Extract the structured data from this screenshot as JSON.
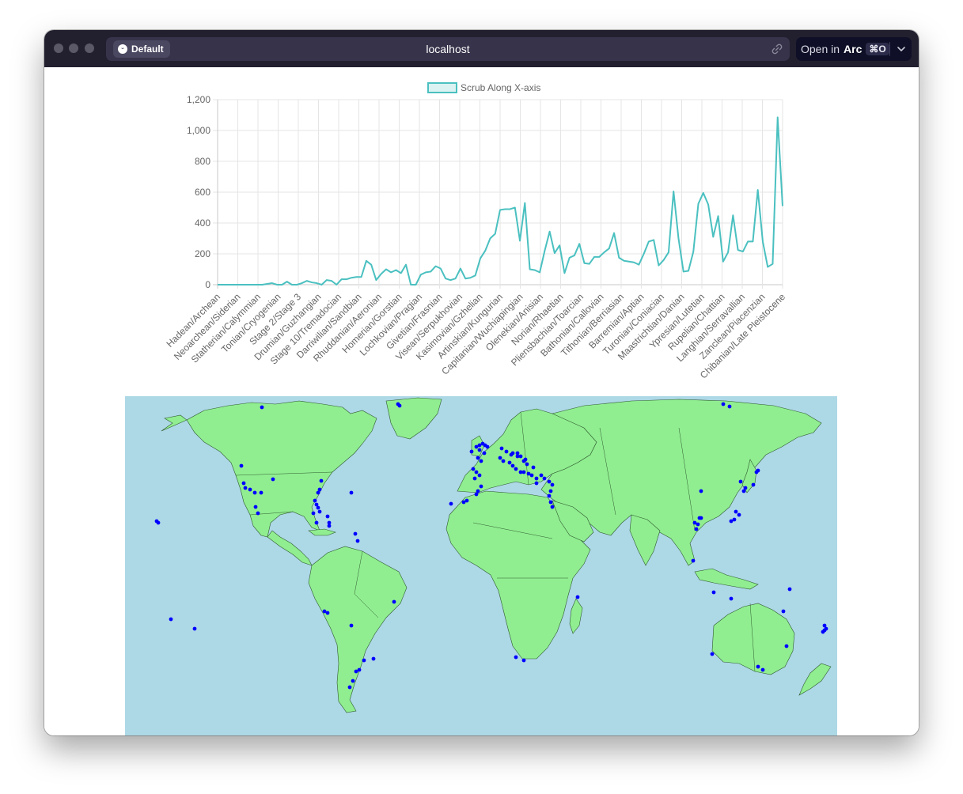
{
  "browser": {
    "profile_label": "Default",
    "url": "localhost",
    "open_in_prefix": "Open in",
    "open_in_app": "Arc",
    "open_in_shortcut": "⌘O"
  },
  "colors": {
    "line": "#4bc0c0",
    "legend_fill": "rgba(75,192,192,0.2)",
    "ocean": "#add8e6",
    "land": "#90ee90",
    "marker": "#0000ff",
    "titlebar": "#221f2f"
  },
  "chart_data": {
    "type": "line",
    "legend": [
      "Scrub Along X-axis"
    ],
    "legend_position": "top",
    "grid": true,
    "ylim": [
      0,
      1200
    ],
    "yticks": [
      0,
      200,
      400,
      600,
      800,
      1000,
      1200
    ],
    "ytick_labels": [
      "0",
      "200",
      "400",
      "600",
      "800",
      "1,000",
      "1,200"
    ],
    "tick_labels": [
      "Hadean/Archean",
      "Neoarchean/Siderian",
      "Statherian/Calymmian",
      "Tonian/Cryogenian",
      "Stage 2/Stage 3",
      "Drumian/Guzhangian",
      "Stage 10/Tremadocian",
      "Darriwilian/Sandbian",
      "Rhuddanian/Aeronian",
      "Homerian/Gorstian",
      "Lochkovian/Pragian",
      "Givetian/Frasnian",
      "Visean/Serpukhovian",
      "Kasimovian/Gzhelian",
      "Artinskian/Kungurian",
      "Capitanian/Wuchiapingian",
      "Olenekian/Anisian",
      "Norian/Rhaetian",
      "Pliensbachian/Toarcian",
      "Bathonian/Callovian",
      "Tithonian/Berriasian",
      "Barremian/Aptian",
      "Turonian/Coniacian",
      "Maastrichtian/Danian",
      "Ypresian/Lutetian",
      "Rupelian/Chattian",
      "Langhian/Serravallian",
      "Zanclean/Piacenzian",
      "Chibanian/Late Pleistocene"
    ],
    "series": [
      {
        "name": "Scrub Along X-axis",
        "values": [
          0,
          0,
          0,
          0,
          0,
          0,
          0,
          0,
          0,
          0,
          5,
          10,
          0,
          0,
          20,
          0,
          0,
          10,
          25,
          15,
          10,
          0,
          30,
          25,
          0,
          35,
          35,
          45,
          50,
          50,
          155,
          130,
          30,
          70,
          100,
          80,
          95,
          75,
          130,
          0,
          0,
          65,
          80,
          85,
          120,
          105,
          40,
          30,
          40,
          105,
          40,
          45,
          60,
          170,
          220,
          300,
          330,
          485,
          490,
          490,
          500,
          285,
          530,
          100,
          95,
          80,
          220,
          345,
          205,
          255,
          75,
          175,
          190,
          265,
          140,
          135,
          180,
          180,
          210,
          235,
          335,
          175,
          155,
          150,
          145,
          130,
          200,
          280,
          290,
          125,
          160,
          210,
          605,
          300,
          85,
          90,
          215,
          525,
          595,
          520,
          310,
          445,
          150,
          210,
          450,
          225,
          215,
          280,
          280,
          615,
          280,
          115,
          135,
          1085,
          510
        ]
      }
    ]
  },
  "map": {
    "title": ""
  }
}
